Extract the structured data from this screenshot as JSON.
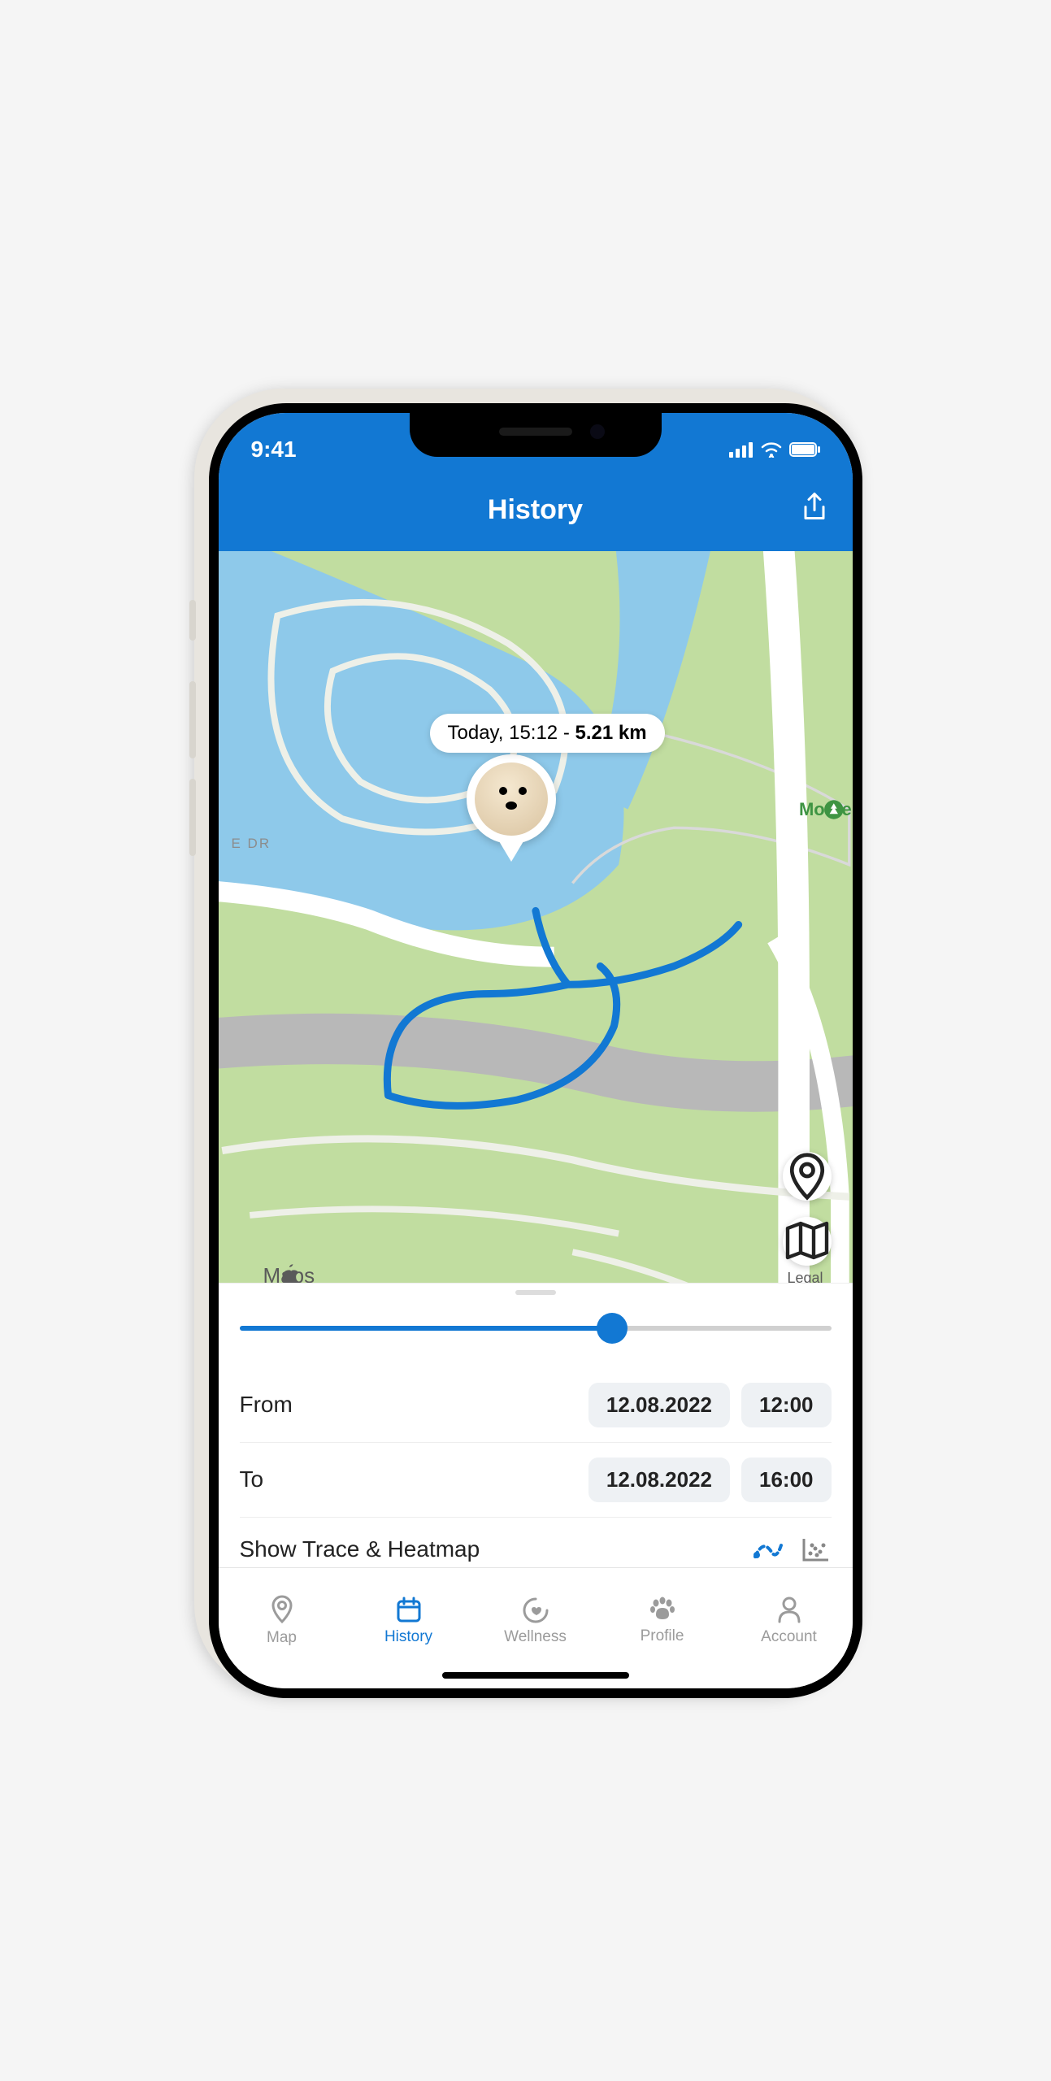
{
  "status": {
    "time": "9:41"
  },
  "header": {
    "title": "History"
  },
  "callout": {
    "prefix": "Today, 15:12 - ",
    "distance": "5.21 km"
  },
  "map": {
    "poi": "Mothers",
    "street": "E DR",
    "attribution": "Maps",
    "legal": "Legal"
  },
  "slider": {
    "percent": 63
  },
  "range": {
    "from_label": "From",
    "to_label": "To",
    "from_date": "12.08.2022",
    "from_time": "12:00",
    "to_date": "12.08.2022",
    "to_time": "16:00"
  },
  "trace": {
    "label": "Show Trace & Heatmap"
  },
  "tabs": [
    {
      "label": "Map",
      "icon": "pin",
      "active": false
    },
    {
      "label": "History",
      "icon": "calendar",
      "active": true
    },
    {
      "label": "Wellness",
      "icon": "heart-ring",
      "active": false
    },
    {
      "label": "Profile",
      "icon": "paw",
      "active": false
    },
    {
      "label": "Account",
      "icon": "person",
      "active": false
    }
  ],
  "colors": {
    "primary": "#1278d3",
    "land": "#c1dda0",
    "water": "#8ec9ea",
    "road": "#b8b8b8",
    "path": "#eef0e8"
  }
}
